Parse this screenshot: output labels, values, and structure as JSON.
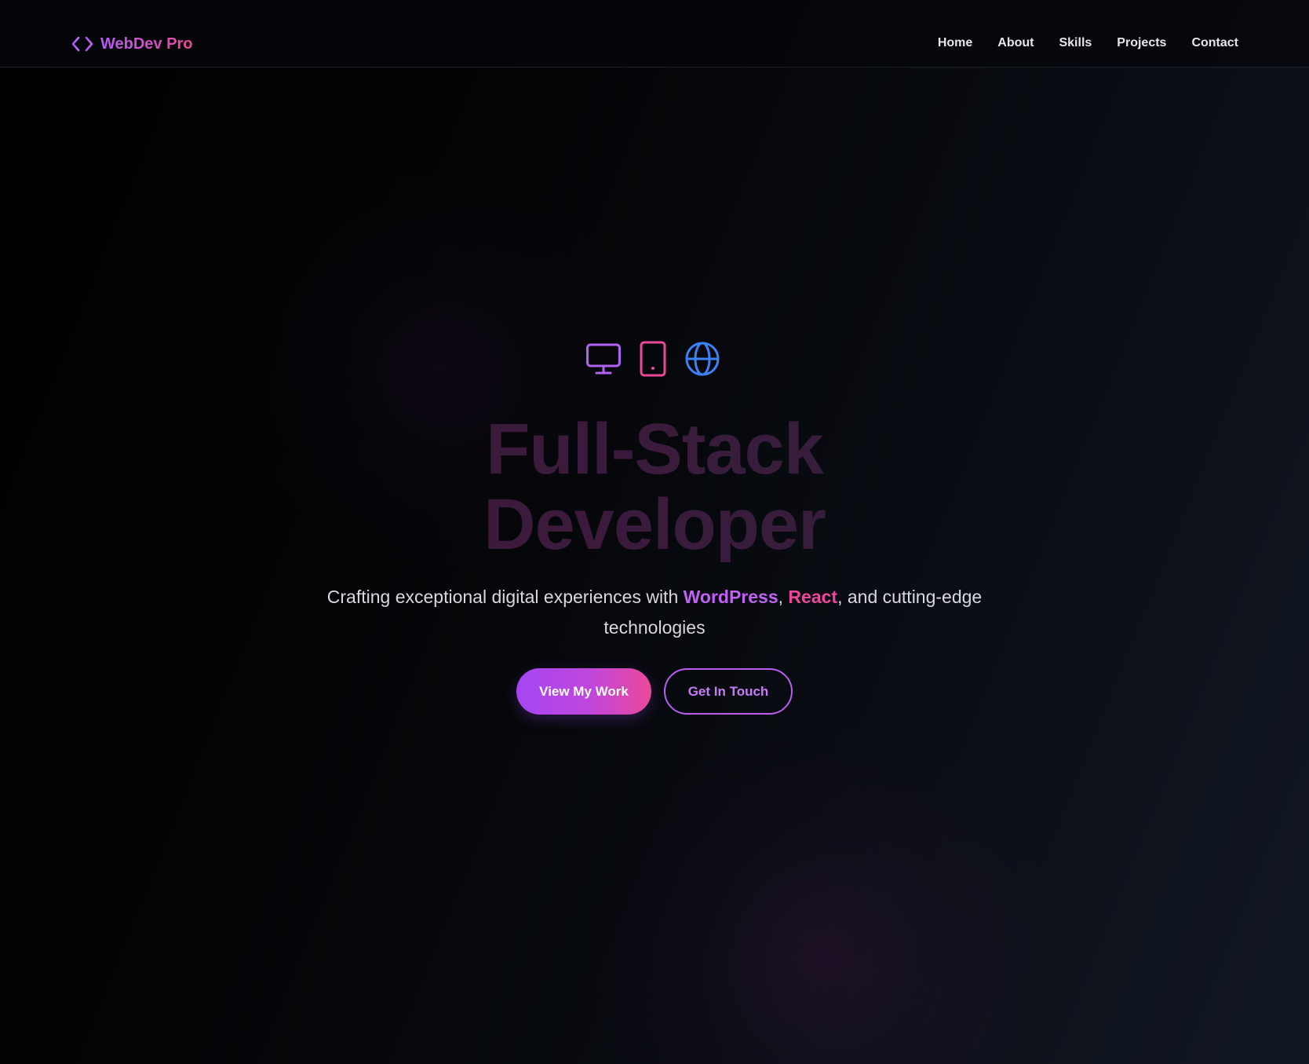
{
  "brand": {
    "name": "WebDev Pro",
    "icon": "code-brackets-icon"
  },
  "nav": {
    "items": [
      {
        "label": "Home"
      },
      {
        "label": "About"
      },
      {
        "label": "Skills"
      },
      {
        "label": "Projects"
      },
      {
        "label": "Contact"
      }
    ]
  },
  "hero": {
    "icons": [
      "monitor-icon",
      "tablet-icon",
      "globe-icon"
    ],
    "headline_line1": "Full-Stack",
    "headline_line2": "Developer",
    "tagline_prefix": "Crafting exceptional digital experiences with ",
    "tagline_highlight1": "WordPress",
    "tagline_sep": ", ",
    "tagline_highlight2": "React",
    "tagline_suffix": ", and cutting-edge technologies",
    "primary_button": "View My Work",
    "secondary_button": "Get In Touch"
  },
  "colors": {
    "accent_purple": "#c062f2",
    "accent_pink": "#ec4899",
    "accent_blue": "#3b82f6",
    "background": "#000000"
  }
}
